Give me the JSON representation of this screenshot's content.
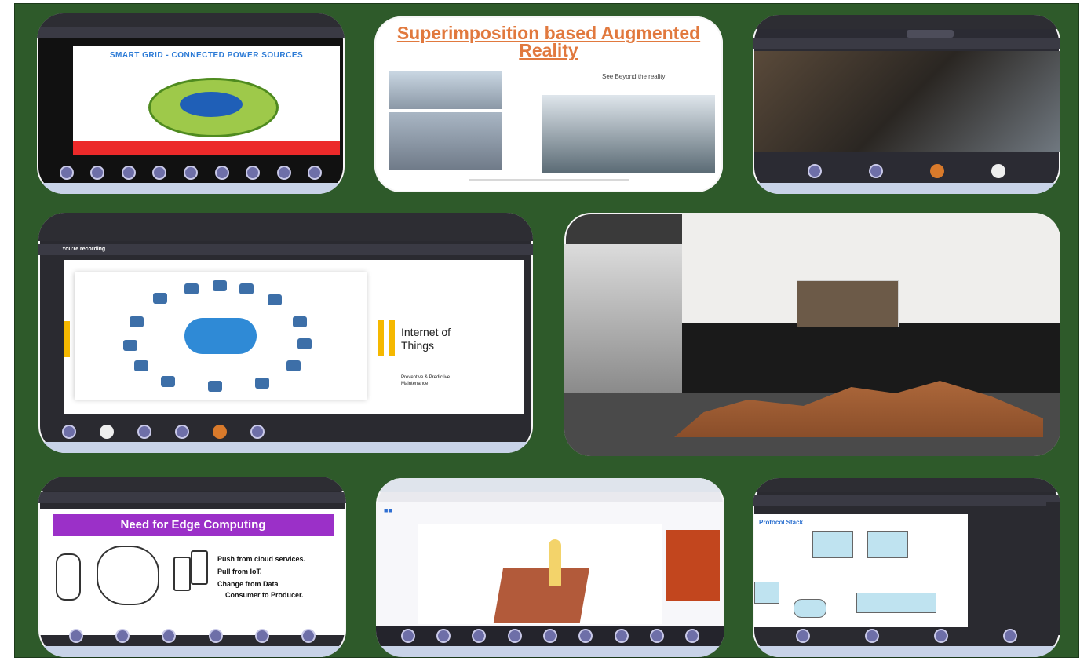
{
  "smart_grid": {
    "title": "SMART GRID - CONNECTED POWER SOURCES"
  },
  "ar_slide": {
    "title_line1": "Superimposition based Augmented",
    "title_line2": "Reality",
    "caption": "See Beyond the reality"
  },
  "iot_slide": {
    "recording_label": "You're recording",
    "title_line1": "Internet of",
    "title_line2": "Things",
    "sub_line1": "Preventive & Predictive",
    "sub_line2": "Maintenance"
  },
  "edge_slide": {
    "title": "Need for Edge Computing",
    "bullets": [
      "Push from cloud services.",
      "Pull from IoT.",
      "Change from Data",
      "Consumer to Producer."
    ]
  },
  "proto_slide": {
    "title": "Protocol Stack"
  },
  "colors": {
    "background_green": "#2e5a2a",
    "ar_title": "#e1793e",
    "edge_header": "#9b30c8",
    "iot_accent": "#f5b800"
  }
}
